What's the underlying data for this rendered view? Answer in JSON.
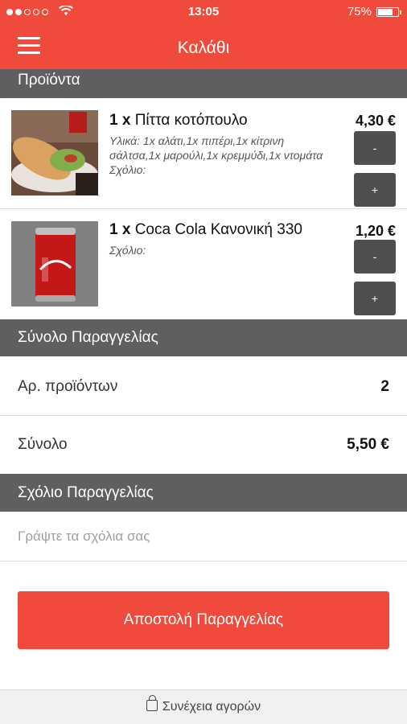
{
  "status_bar": {
    "time": "13:05",
    "battery": "75%",
    "battery_level": 0.75,
    "signal_bars": 2,
    "signal_total": 5
  },
  "header": {
    "title": "Καλάθι",
    "menu_icon": "hamburger-menu-icon"
  },
  "products_section": {
    "title": "Προϊόντα"
  },
  "cart_items": [
    {
      "quantity": "1 x",
      "name": "Πίττα κοτόπουλο",
      "ingredients": "Υλικά: 1x αλάτι,1x πιπέρι,1x κίτρινη σάλτσα,1x μαρούλι,1x κρεμμύδι,1x ντομάτα",
      "comment": "Σχόλιο:",
      "price": "4,30 €",
      "minus_label": "-",
      "plus_label": "+"
    },
    {
      "quantity": "1 x",
      "name": "Coca Cola Κανονική 330",
      "comment": "Σχόλιο:",
      "price": "1,20 €",
      "minus_label": "-",
      "plus_label": "+"
    }
  ],
  "summary_section": {
    "title": "Σύνολο Παραγγελίας",
    "count_label": "Αρ. προϊόντων",
    "count_value": "2",
    "total_label": "Σύνολο",
    "total_value": "5,50 €"
  },
  "comment_section": {
    "title": "Σχόλιο Παραγγελίας",
    "placeholder": "Γράψτε τα σχόλια σας",
    "value": ""
  },
  "send_button": {
    "label": "Αποστολή Παραγγελίας"
  },
  "bottom_bar": {
    "label": "Συνέχεια αγορών",
    "icon": "shopping-bag-icon"
  },
  "colors": {
    "accent": "#ef4a3c",
    "section_header": "#5f5f5f",
    "qty_button": "#4f4f4f"
  }
}
